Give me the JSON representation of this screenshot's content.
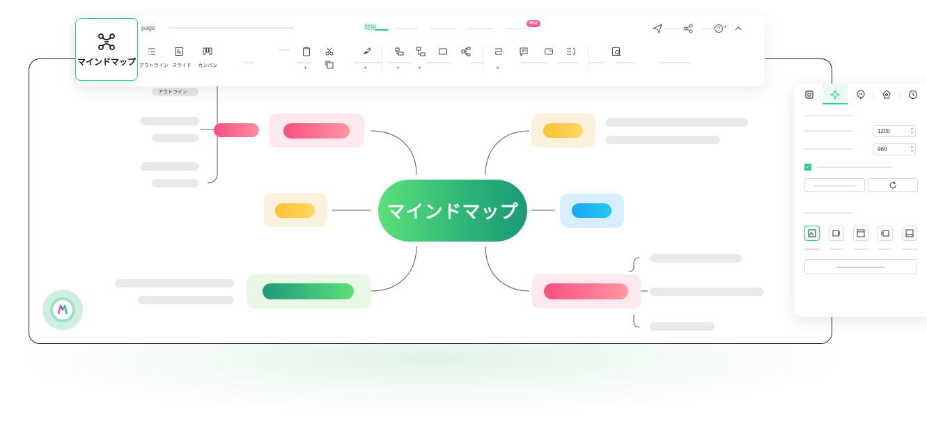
{
  "app": {
    "name": "マインドマップ",
    "tab_partial": "page",
    "menu_start": "開始",
    "hot_badge": "Hot"
  },
  "views": [
    {
      "label": "アウトライン",
      "icon": "outline-icon"
    },
    {
      "label": "スライド",
      "icon": "slide-icon"
    },
    {
      "label": "カンバン",
      "icon": "kanban-icon"
    }
  ],
  "outline_chip": "アウトライン",
  "central_topic": "マインドマップ",
  "side_panel": {
    "width_value": "1200",
    "height_value": "960",
    "checkbox_checked": true
  },
  "colors": {
    "accent": "#2ecc8c",
    "central_start": "#5be079",
    "central_end": "#1c9a7a",
    "pink": "#fa4f7f",
    "yellow": "#ffc83d",
    "blue": "#1aa7f5"
  }
}
